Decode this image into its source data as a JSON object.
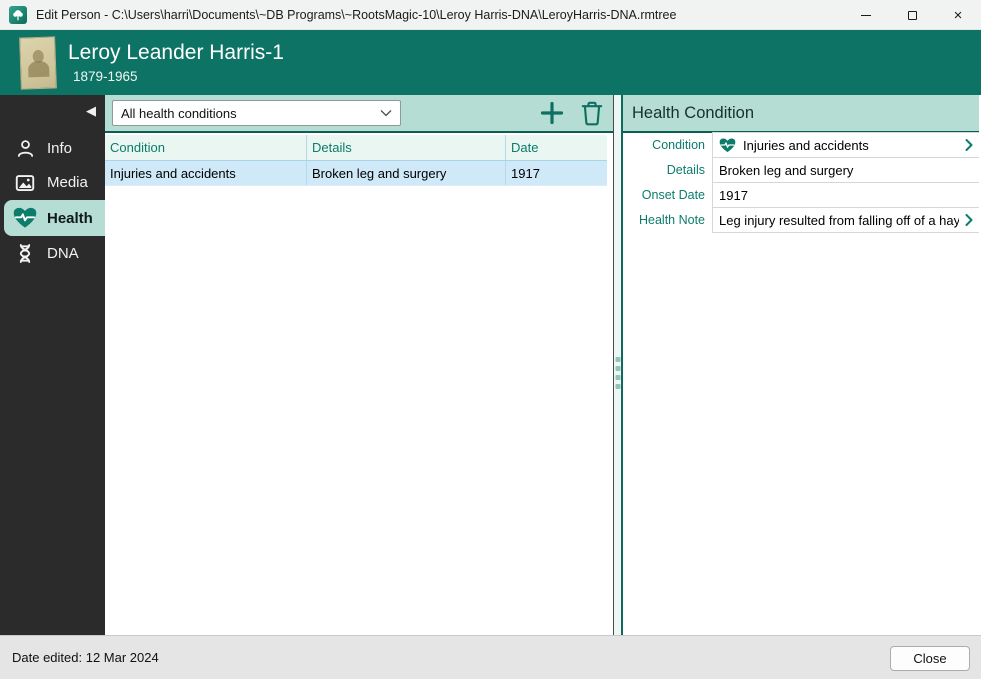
{
  "window": {
    "title": "Edit Person - C:\\Users\\harri\\Documents\\~DB Programs\\~RootsMagic-10\\Leroy Harris-DNA\\LeroyHarris-DNA.rmtree",
    "controls": {
      "close": "×"
    }
  },
  "header": {
    "name": "Leroy Leander Harris-1",
    "years": "1879-1965"
  },
  "sidebar": {
    "collapse_glyph": "◀",
    "items": [
      {
        "label": "Info",
        "icon": "person-icon",
        "selected": false
      },
      {
        "label": "Media",
        "icon": "media-icon",
        "selected": false
      },
      {
        "label": "Health",
        "icon": "health-icon",
        "selected": true
      },
      {
        "label": "DNA",
        "icon": "dna-icon",
        "selected": false
      }
    ]
  },
  "toolbar": {
    "filter_value": "All health conditions"
  },
  "table": {
    "columns": [
      "Condition",
      "Details",
      "Date"
    ],
    "rows": [
      [
        "Injuries and accidents",
        "Broken leg and surgery",
        "1917"
      ]
    ]
  },
  "detail": {
    "title": "Health Condition",
    "fields": [
      {
        "label": "Condition",
        "value": "Injuries and accidents"
      },
      {
        "label": "Details",
        "value": "Broken leg and surgery"
      },
      {
        "label": "Onset Date",
        "value": "1917"
      },
      {
        "label": "Health Note",
        "value": "Leg injury resulted from falling off of a hay..."
      }
    ]
  },
  "statusbar": {
    "date_edited": "Date edited: 12 Mar 2024",
    "close_label": "Close"
  },
  "colors": {
    "accent_teal": "#0e7c6b",
    "header_teal": "#0d7364",
    "mint": "#b5ddd3",
    "selection_blue": "#cfe9f8",
    "sidebar_dark": "#2b2b2b"
  }
}
